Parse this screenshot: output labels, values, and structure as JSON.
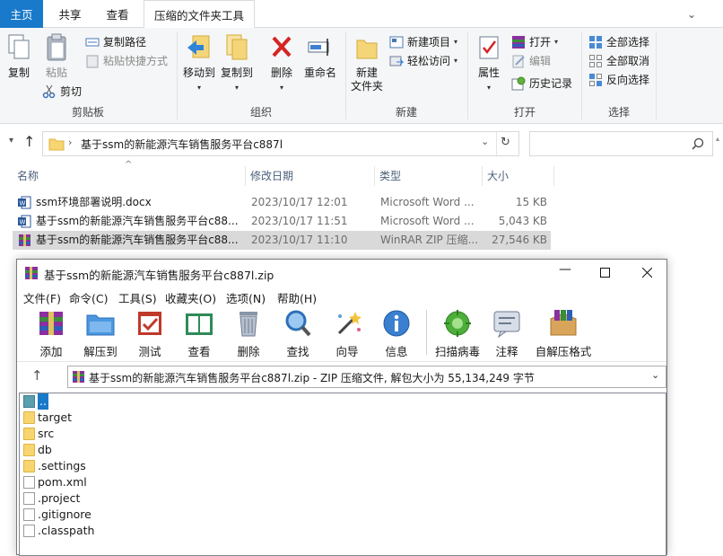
{
  "tabs": {
    "home": "主页",
    "share": "共享",
    "view": "查看",
    "compressed_tools": "压缩的文件夹工具"
  },
  "ribbon": {
    "clipboard": {
      "group": "剪贴板",
      "copy": "复制",
      "paste": "粘贴",
      "cut": "剪切",
      "copy_path": "复制路径",
      "paste_shortcut": "粘贴快捷方式"
    },
    "organize": {
      "group": "组织",
      "move_to": "移动到",
      "copy_to": "复制到",
      "delete": "删除",
      "rename": "重命名"
    },
    "new": {
      "group": "新建",
      "new_folder": "新建\n文件夹",
      "new_item": "新建项目",
      "easy_access": "轻松访问"
    },
    "open": {
      "group": "打开",
      "properties": "属性",
      "open": "打开",
      "edit": "编辑",
      "history": "历史记录"
    },
    "select": {
      "group": "选择",
      "select_all": "全部选择",
      "select_none": "全部取消",
      "invert": "反向选择"
    }
  },
  "address": {
    "path": "基于ssm的新能源汽车销售服务平台c887l"
  },
  "columns": {
    "name": "名称",
    "date": "修改日期",
    "type": "类型",
    "size": "大小"
  },
  "files": [
    {
      "name": "ssm环境部署说明.docx",
      "date": "2023/10/17 12:01",
      "type": "Microsoft Word ...",
      "size": "15 KB",
      "icon": "word-icon"
    },
    {
      "name": "基于ssm的新能源汽车销售服务平台c88...",
      "date": "2023/10/17 11:51",
      "type": "Microsoft Word ...",
      "size": "5,043 KB",
      "icon": "word-icon"
    },
    {
      "name": "基于ssm的新能源汽车销售服务平台c88...",
      "date": "2023/10/17 11:10",
      "type": "WinRAR ZIP 压缩...",
      "size": "27,546 KB",
      "icon": "winrar-icon"
    }
  ],
  "rar": {
    "title": "基于ssm的新能源汽车销售服务平台c887l.zip",
    "menu": [
      "文件(F)",
      "命令(C)",
      "工具(S)",
      "收藏夹(O)",
      "选项(N)",
      "帮助(H)"
    ],
    "toolbar": [
      "添加",
      "解压到",
      "测试",
      "查看",
      "删除",
      "查找",
      "向导",
      "信息",
      "扫描病毒",
      "注释",
      "自解压格式"
    ],
    "path": "基于ssm的新能源汽车销售服务平台c887l.zip - ZIP 压缩文件, 解包大小为 55,134,249 字节",
    "items": [
      {
        "name": "..",
        "kind": "up"
      },
      {
        "name": "target",
        "kind": "folder"
      },
      {
        "name": "src",
        "kind": "folder"
      },
      {
        "name": "db",
        "kind": "folder"
      },
      {
        "name": ".settings",
        "kind": "folder"
      },
      {
        "name": "pom.xml",
        "kind": "file"
      },
      {
        "name": ".project",
        "kind": "file"
      },
      {
        "name": ".gitignore",
        "kind": "file"
      },
      {
        "name": ".classpath",
        "kind": "file"
      }
    ]
  },
  "colors": {
    "accent": "#1979ca",
    "selection": "#d9d9d9",
    "folder": "#f7d570"
  }
}
